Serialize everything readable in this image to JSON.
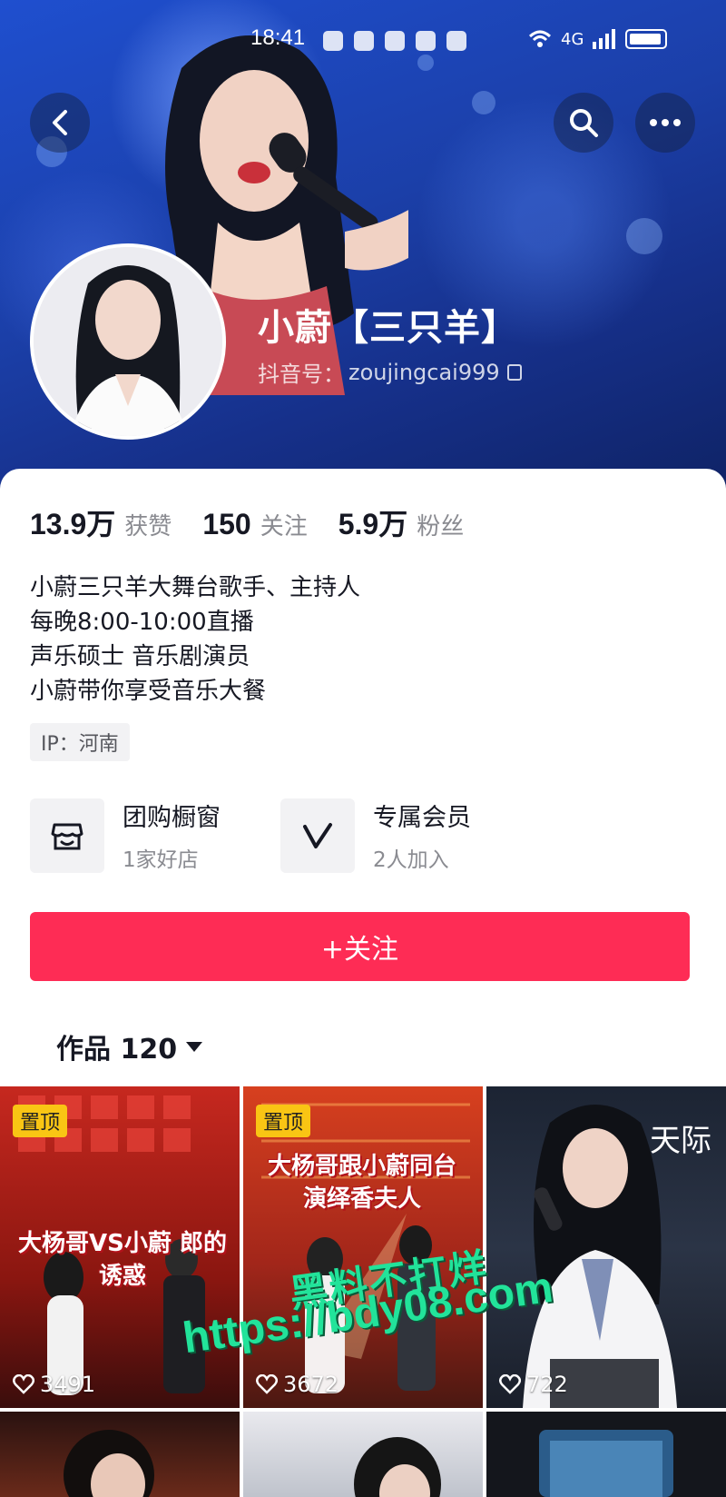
{
  "status_bar": {
    "time": "18:41",
    "network": "4G"
  },
  "header": {
    "back_icon": "chevron-left-icon",
    "search_icon": "search-icon",
    "more_icon": "more-horizontal-icon"
  },
  "profile": {
    "name": "小蔚【三只羊】",
    "id_label": "抖音号：",
    "id_value": "zoujingcai999"
  },
  "stats": [
    {
      "value": "13.9万",
      "label": "获赞"
    },
    {
      "value": "150",
      "label": "关注"
    },
    {
      "value": "5.9万",
      "label": "粉丝"
    }
  ],
  "bio": [
    "小蔚三只羊大舞台歌手、主持人",
    "每晚8:00-10:00直播",
    "声乐硕士 音乐剧演员",
    "小蔚带你享受音乐大餐"
  ],
  "ip": "IP：河南",
  "features": [
    {
      "title": "团购橱窗",
      "subtitle": "1家好店",
      "icon": "shop-icon"
    },
    {
      "title": "专属会员",
      "subtitle": "2人加入",
      "icon": "member-v-icon"
    }
  ],
  "follow_button": "+关注",
  "works_tab": "作品 120",
  "videos": [
    {
      "pinned": "置顶",
      "caption": "大杨哥VS小蔚 郎的诱惑",
      "likes": "3491"
    },
    {
      "pinned": "置顶",
      "caption": "大杨哥跟小蔚同台演绎香夫人",
      "likes": "3672"
    },
    {
      "pinned": "",
      "caption": "天际",
      "likes": "722"
    }
  ],
  "watermark": {
    "line1": "黑料不打烊",
    "line2": "https://bdy08.com"
  },
  "colors": {
    "accent": "#fe2c55",
    "pin_badge": "#f9c514",
    "watermark": "#22e39a"
  }
}
